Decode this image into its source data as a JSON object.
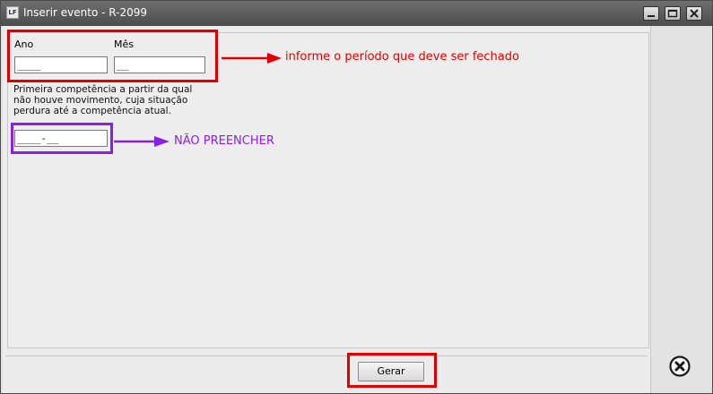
{
  "window": {
    "title": "Inserir evento - R-2099",
    "app_icon_text": "LF"
  },
  "form": {
    "ano_label": "Ano",
    "ano_value": "____",
    "mes_label": "Mês",
    "mes_value": "__",
    "description_lines": [
      "Primeira competência a partir da qual",
      "não houve movimento, cuja situação",
      "perdura até a competência atual."
    ],
    "competencia_value": "____-__",
    "generate_label": "Gerar"
  },
  "annotations": {
    "period_note": "informe o período que deve ser fechado",
    "do_not_fill_note": "NÃO PREENCHER",
    "red_color": "#e00000",
    "purple_color": "#8b1fe8"
  },
  "icons": {
    "minimize": "minimize-icon",
    "maximize": "maximize-icon",
    "close": "close-icon",
    "cancel": "circle-x-icon"
  }
}
